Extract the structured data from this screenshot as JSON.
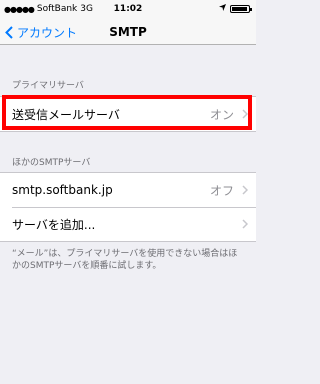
{
  "status_bar": {
    "carrier": "SoftBank",
    "network": "3G",
    "time": "11:02"
  },
  "nav": {
    "back_label": "アカウント",
    "title": "SMTP"
  },
  "primary_section": {
    "header": "プライマリサーバ",
    "server_label": "送受信メールサーバ",
    "server_value": "オン"
  },
  "other_section": {
    "header": "ほかのSMTPサーバ",
    "items": [
      {
        "label": "smtp.softbank.jp",
        "value": "オフ"
      },
      {
        "label": "サーバを追加...",
        "value": ""
      }
    ]
  },
  "footer_note": "“メール”は、プライマリサーバを使用できない場合はほかのSMTPサーバを順番に試します。",
  "colors": {
    "accent": "#007aff",
    "highlight": "#ff0000",
    "background": "#efeff4"
  }
}
